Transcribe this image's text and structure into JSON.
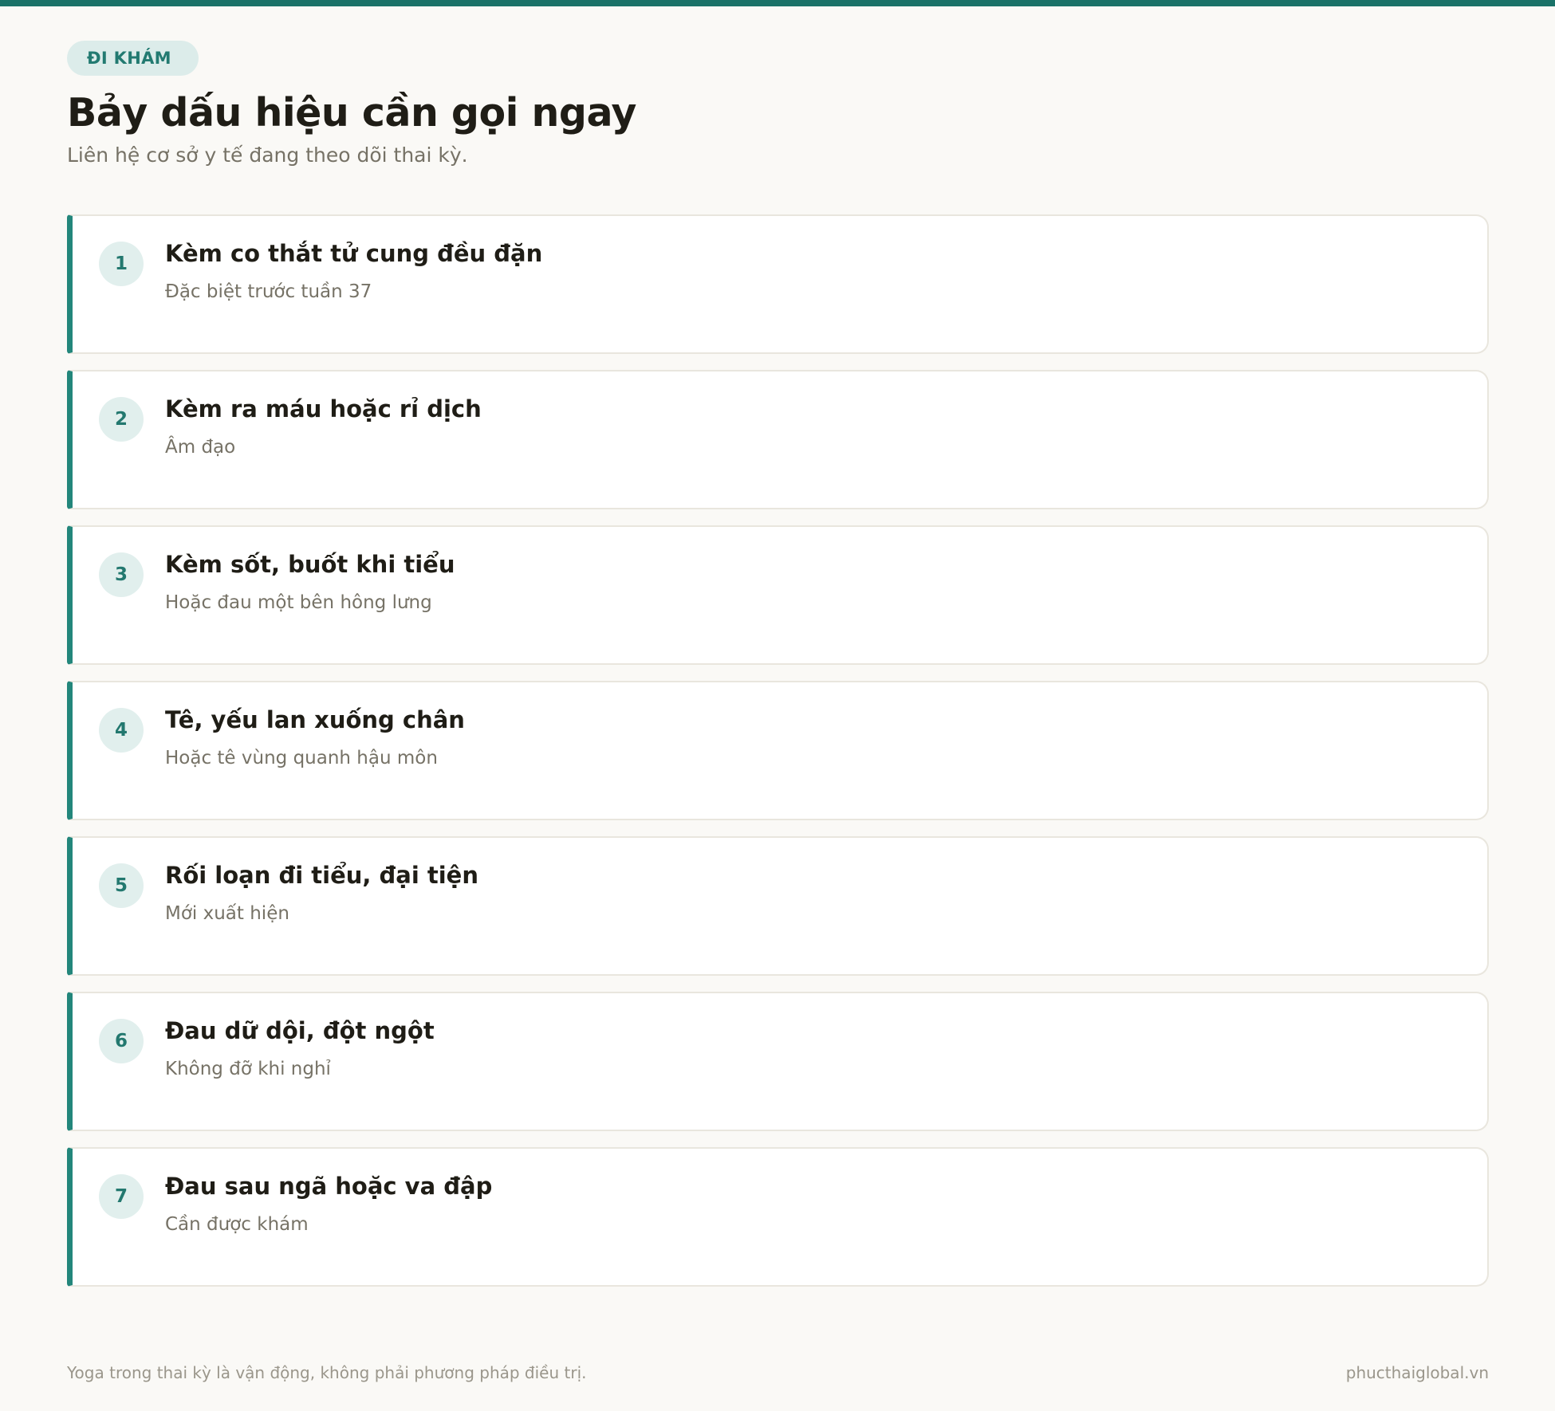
{
  "header": {
    "badge": "ĐI KHÁM",
    "title": "Bảy dấu hiệu cần gọi ngay",
    "subtitle": "Liên hệ cơ sở y tế đang theo dõi thai kỳ."
  },
  "items": [
    {
      "number": "1",
      "title": "Kèm co thắt tử cung đều đặn",
      "description": "Đặc biệt trước tuần 37"
    },
    {
      "number": "2",
      "title": "Kèm ra máu hoặc rỉ dịch",
      "description": "Âm đạo"
    },
    {
      "number": "3",
      "title": "Kèm sốt, buốt khi tiểu",
      "description": "Hoặc đau một bên hông lưng"
    },
    {
      "number": "4",
      "title": "Tê, yếu lan xuống chân",
      "description": "Hoặc tê vùng quanh hậu môn"
    },
    {
      "number": "5",
      "title": "Rối loạn đi tiểu, đại tiện",
      "description": "Mới xuất hiện"
    },
    {
      "number": "6",
      "title": "Đau dữ dội, đột ngột",
      "description": "Không đỡ khi nghỉ"
    },
    {
      "number": "7",
      "title": "Đau sau ngã hoặc va đập",
      "description": "Cần được khám"
    }
  ],
  "footer": {
    "disclaimer": "Yoga trong thai kỳ là vận động, không phải phương pháp điều trị.",
    "site": "phucthaiglobal.vn"
  },
  "colors": {
    "accent": "#1a7268",
    "background": "#faf9f6"
  }
}
